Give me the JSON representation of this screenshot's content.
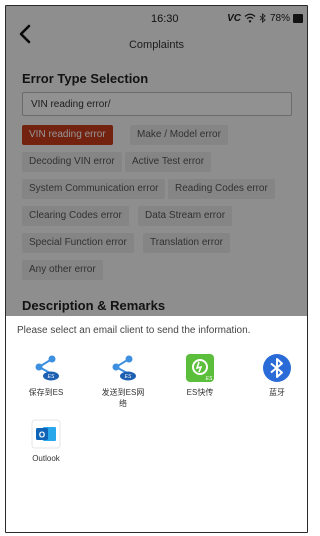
{
  "status_bar": {
    "time": "16:30",
    "battery": "78%",
    "vci_label": "VC"
  },
  "header": {
    "title": "Complaints"
  },
  "error_type": {
    "heading": "Error Type Selection",
    "input_value": "VIN reading error/",
    "chips": [
      {
        "label": "VIN reading error",
        "selected": true
      },
      {
        "label": "Make / Model error",
        "selected": false
      },
      {
        "label": "Decoding VIN error",
        "selected": false
      },
      {
        "label": "Active Test error",
        "selected": false
      },
      {
        "label": "System Communication error",
        "selected": false
      },
      {
        "label": "Reading Codes error",
        "selected": false
      },
      {
        "label": "Clearing Codes error",
        "selected": false
      },
      {
        "label": "Data Stream error",
        "selected": false
      },
      {
        "label": "Special Function error",
        "selected": false
      },
      {
        "label": "Translation error",
        "selected": false
      },
      {
        "label": "Any other error",
        "selected": false
      }
    ]
  },
  "description": {
    "heading": "Description & Remarks"
  },
  "share_sheet": {
    "message": "Please select an email client to send the information.",
    "apps": [
      {
        "label": "保存到ES",
        "icon": "es-share-icon"
      },
      {
        "label": "发送到ES网\n络",
        "icon": "es-share-icon"
      },
      {
        "label": "ES快传",
        "icon": "es-quick-transfer-icon"
      },
      {
        "label": "蓝牙",
        "icon": "bluetooth-icon"
      },
      {
        "label": "Outlook",
        "icon": "outlook-icon"
      }
    ]
  },
  "colors": {
    "accent": "#c73b1c",
    "bluetooth": "#2a6bd8",
    "es_green": "#5bbf3b",
    "outlook": "#1470c4"
  }
}
